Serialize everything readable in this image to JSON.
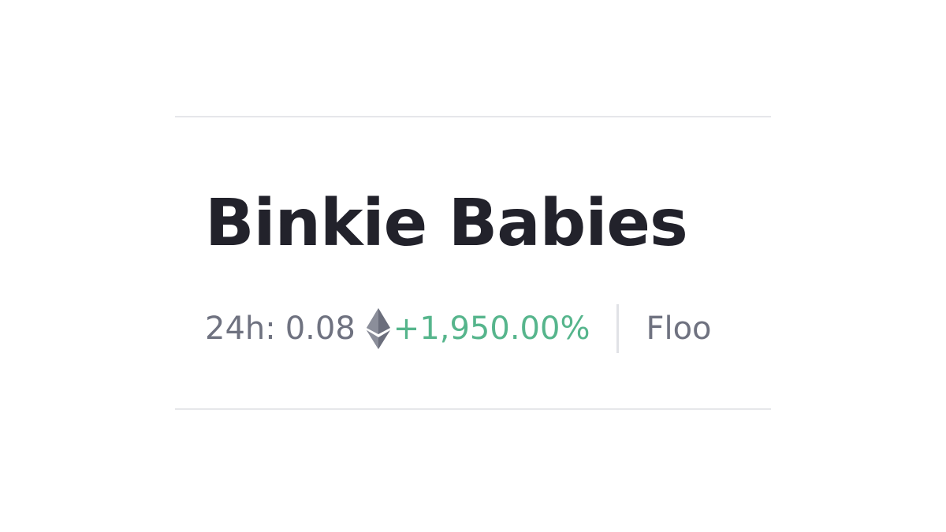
{
  "collection": {
    "name": "Binkie Babies"
  },
  "stats": {
    "volume_24h": {
      "label": "24h:",
      "value": "0.08",
      "currency_icon": "ethereum-icon",
      "change": "+1,950.00%",
      "change_color": "#56b58c"
    },
    "floor": {
      "label_visible": "Floo"
    }
  },
  "colors": {
    "title": "#22222b",
    "muted_text": "#6f7280",
    "positive": "#56b58c",
    "divider": "#e6e7ea"
  }
}
